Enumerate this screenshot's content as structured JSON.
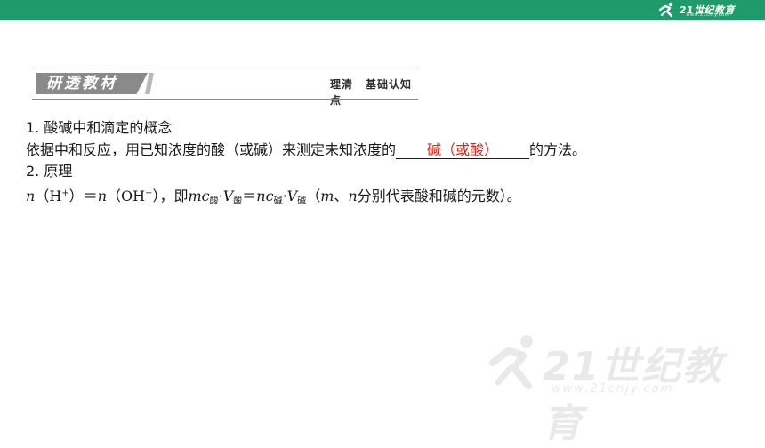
{
  "brand": {
    "logo_text": "21世纪教育",
    "logo_url": "www.21cnjy.com",
    "accent_color": "#1f9a6a"
  },
  "section": {
    "tab_label": "研透教材",
    "subtitle_a": "理清",
    "subtitle_b": "基础认知点"
  },
  "body": {
    "heading1": "1. 酸碱中和滴定的概念",
    "p1_before": "依据中和反应，用已知浓度的酸（或碱）来测定未知浓度的",
    "p1_answer": "碱（或酸）",
    "p1_after": "的方法。",
    "heading2": "2. 原理",
    "f_n1": "n",
    "f_lp1": "（H",
    "f_plus": "+",
    "f_rp1": "）＝",
    "f_n2": "n",
    "f_lp2": "（OH",
    "f_minus": "−",
    "f_rp2": "），即",
    "f_mc": "mc",
    "f_sub_acid1": "酸",
    "f_dot1": "·",
    "f_V1": "V",
    "f_sub_acid2": "酸",
    "f_eq": "＝",
    "f_nc": "nc",
    "f_sub_base1": "碱",
    "f_dot2": "·",
    "f_V2": "V",
    "f_sub_base2": "碱",
    "f_tail_open": "（",
    "f_m": "m",
    "f_sep": "、",
    "f_n3": "n",
    "f_tail": "分别代表酸和碱的元数）。"
  }
}
